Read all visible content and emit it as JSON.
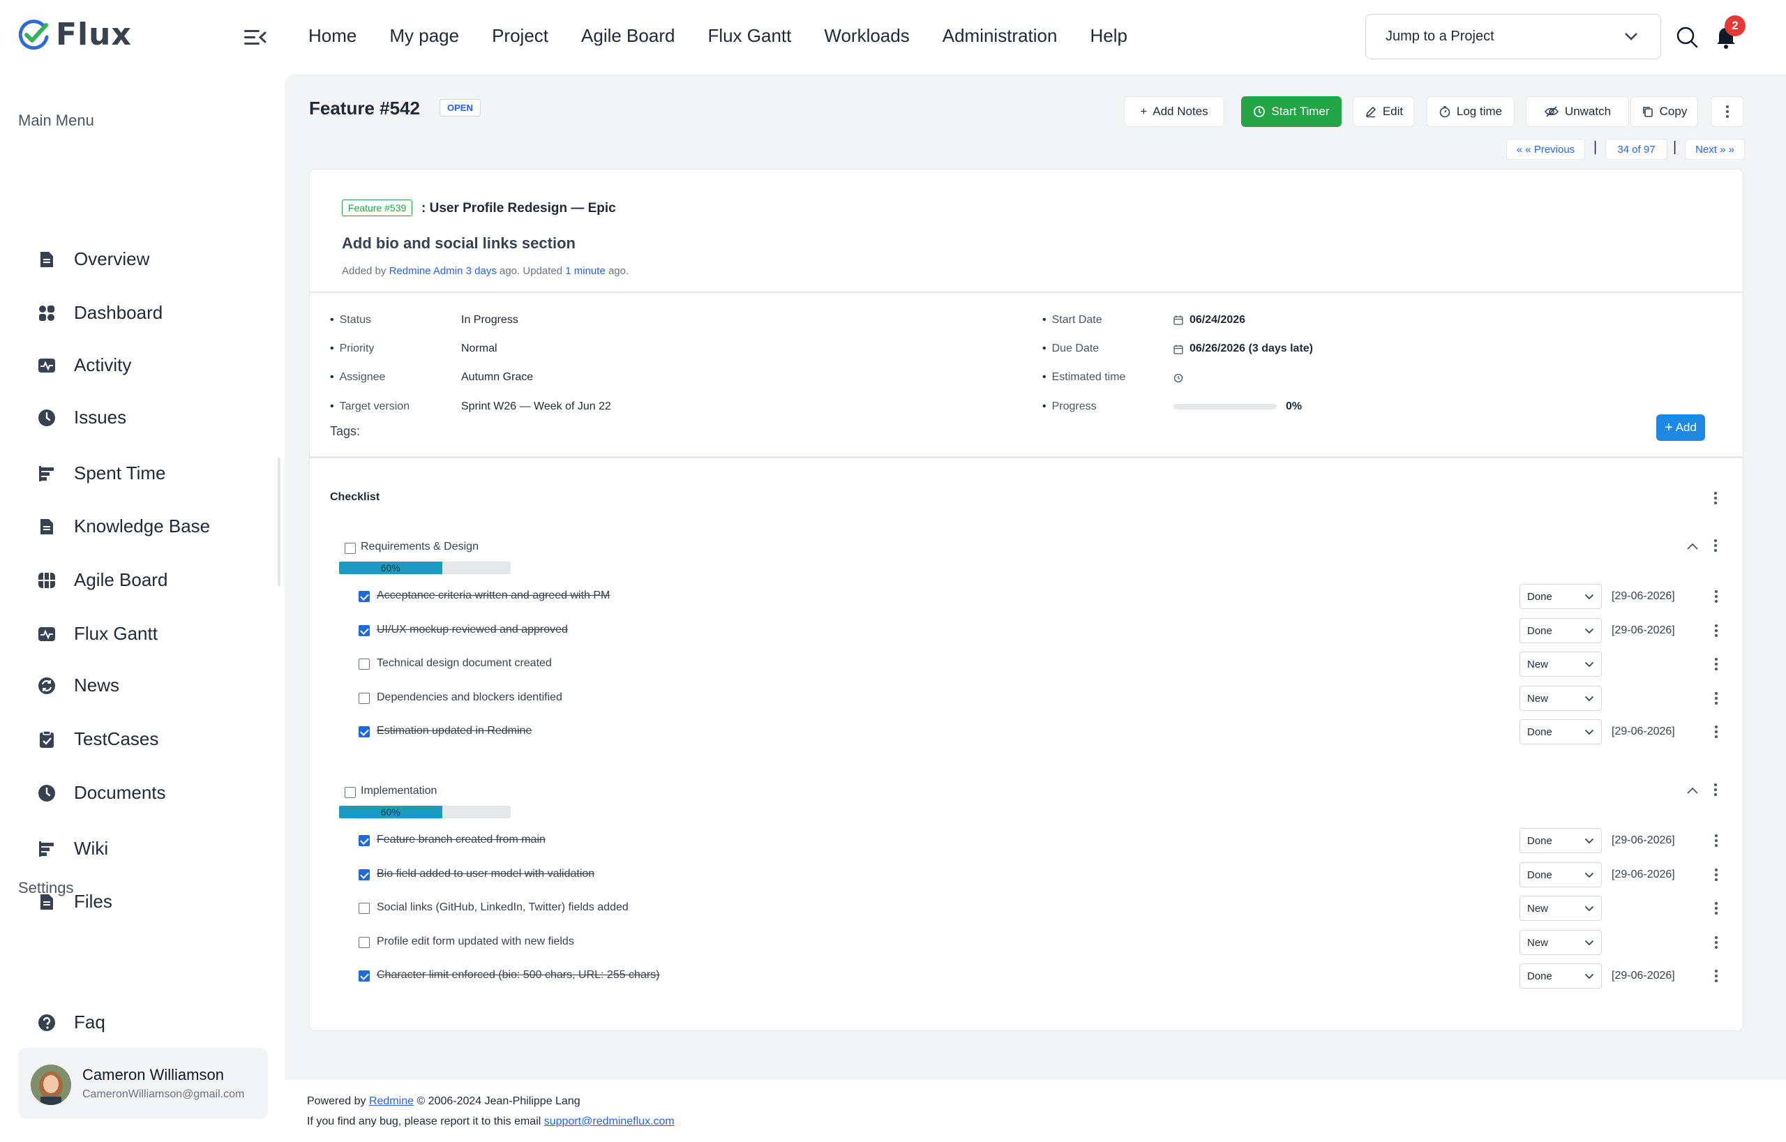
{
  "app": {
    "name": "Flux"
  },
  "topnav": [
    "Home",
    "My page",
    "Project",
    "Agile Board",
    "Flux Gantt",
    "Workloads",
    "Administration",
    "Help"
  ],
  "jump": {
    "label": "Jump to a Project"
  },
  "notifications": {
    "count": "2"
  },
  "sidebar": {
    "main_heading": "Main Menu",
    "items": [
      {
        "label": "Overview",
        "icon": "document-icon"
      },
      {
        "label": "Dashboard",
        "icon": "grid-icon"
      },
      {
        "label": "Activity",
        "icon": "pulse-icon"
      },
      {
        "label": "Issues",
        "icon": "clock-icon"
      },
      {
        "label": "Spent Time",
        "icon": "bars-icon"
      },
      {
        "label": "Knowledge Base",
        "icon": "document-icon"
      },
      {
        "label": "Agile Board",
        "icon": "board-icon"
      },
      {
        "label": "Flux Gantt",
        "icon": "pulse-icon"
      },
      {
        "label": "News",
        "icon": "refresh-icon"
      },
      {
        "label": "TestCases",
        "icon": "clipboard-icon"
      },
      {
        "label": "Documents",
        "icon": "clock-icon"
      },
      {
        "label": "Wiki",
        "icon": "bars-icon"
      },
      {
        "label": "Files",
        "icon": "document-icon"
      }
    ],
    "settings_heading": "Settings",
    "settings_items": [
      {
        "label": "Faq",
        "icon": "question-icon"
      },
      {
        "label": "Settings",
        "icon": "gear-icon"
      }
    ]
  },
  "user": {
    "name": "Cameron Williamson",
    "email": "CameronWilliamson@gmail.com"
  },
  "issue": {
    "title": "Feature #542",
    "status_badge": "OPEN",
    "actions": {
      "add_notes": "Add Notes",
      "start_timer": "Start Timer",
      "edit": "Edit",
      "log_time": "Log time",
      "unwatch": "Unwatch",
      "copy": "Copy"
    },
    "pager": {
      "previous": "« « Previous",
      "position": "34 of 97",
      "next": "Next » »",
      "sep": "|"
    },
    "parent": {
      "badge": "Feature #539",
      "title": ": User Profile Redesign — Epic"
    },
    "subject": "Add bio and social links section",
    "added": {
      "prefix": "Added by",
      "author": "Redmine Admin",
      "created": "3 days",
      "mid": "ago. Updated",
      "updated": "1 minute",
      "suffix": "ago."
    },
    "attributes_left": [
      {
        "label": "Status",
        "value": "In Progress"
      },
      {
        "label": "Priority",
        "value": "Normal"
      },
      {
        "label": "Assignee",
        "value": "Autumn Grace"
      },
      {
        "label": "Target version",
        "value": "Sprint W26 — Week of Jun 22"
      }
    ],
    "attributes_right": [
      {
        "label": "Start Date",
        "value": "06/24/2026"
      },
      {
        "label": "Due Date",
        "value": "06/26/2026 (3 days late)"
      },
      {
        "label": "Estimated time",
        "value": ""
      },
      {
        "label": "Progress",
        "value": "0%",
        "progress": 0
      }
    ],
    "tags_label": "Tags:",
    "add_button": "Add"
  },
  "checklist": {
    "title": "Checklist",
    "groups": [
      {
        "name": "Requirements & Design",
        "percent_label": "60%",
        "percent": 60,
        "items": [
          {
            "text": "Acceptance criteria written and agreed with PM",
            "done": true,
            "status": "Done",
            "date": "[29-06-2026]"
          },
          {
            "text": "UI/UX mockup reviewed and approved",
            "done": true,
            "status": "Done",
            "date": "[29-06-2026]"
          },
          {
            "text": "Technical design document created",
            "done": false,
            "status": "New",
            "date": ""
          },
          {
            "text": "Dependencies and blockers identified",
            "done": false,
            "status": "New",
            "date": ""
          },
          {
            "text": "Estimation updated in Redmine",
            "done": true,
            "status": "Done",
            "date": "[29-06-2026]"
          }
        ]
      },
      {
        "name": "Implementation",
        "percent_label": "60%",
        "percent": 60,
        "items": [
          {
            "text": "Feature branch created from main",
            "done": true,
            "status": "Done",
            "date": "[29-06-2026]"
          },
          {
            "text": "Bio field added to user model with validation",
            "done": true,
            "status": "Done",
            "date": "[29-06-2026]"
          },
          {
            "text": "Social links (GitHub, LinkedIn, Twitter) fields added",
            "done": false,
            "status": "New",
            "date": ""
          },
          {
            "text": "Profile edit form updated with new fields",
            "done": false,
            "status": "New",
            "date": ""
          },
          {
            "text": "Character limit enforced (bio: 500 chars, URL: 255 chars)",
            "done": true,
            "status": "Done",
            "date": "[29-06-2026]"
          }
        ]
      }
    ]
  },
  "footer": {
    "powered_prefix": "Powered by",
    "powered_link": "Redmine",
    "powered_suffix": "© 2006-2024 Jean-Philippe Lang",
    "bug_text": "If you find any bug, please report it to this email",
    "bug_email": "support@redmineflux.com"
  },
  "colors": {
    "accent": "#1e6ad6",
    "green": "#22a447",
    "progress": "#1a9bbf",
    "badge": "#e53935"
  }
}
